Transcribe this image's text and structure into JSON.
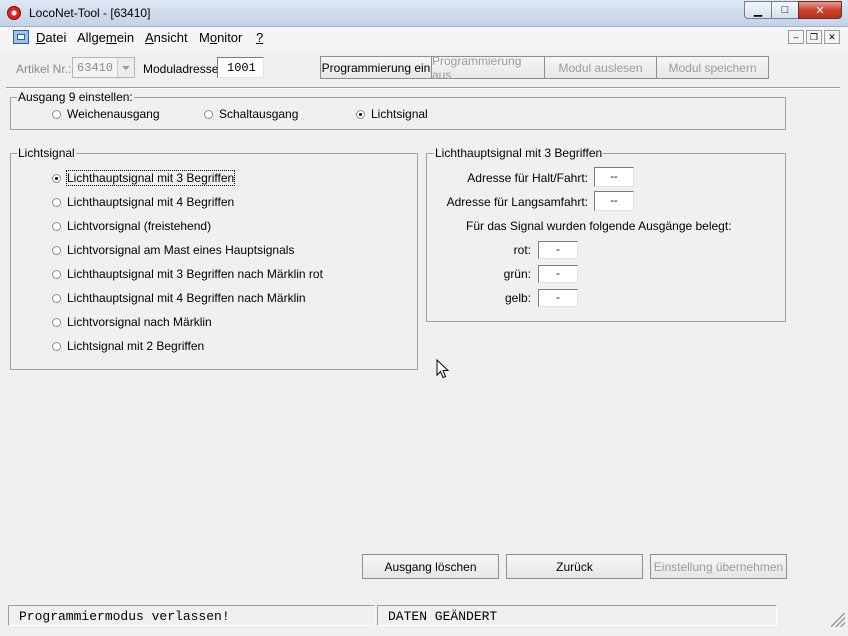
{
  "window": {
    "title": "LocoNet-Tool - [63410]"
  },
  "menu": {
    "items": [
      "Datei",
      "Allgemein",
      "Ansicht",
      "Monitor",
      "?"
    ],
    "mnemonics": [
      "D",
      "m",
      "A",
      "o",
      "?"
    ]
  },
  "toolbar": {
    "artikel_label": "Artikel Nr.:",
    "artikel_value": "63410",
    "modul_label": "Moduladresse:",
    "modul_value": "1001",
    "buttons": [
      {
        "label": "Programmierung ein",
        "enabled": true
      },
      {
        "label": "Programmierung aus",
        "enabled": false
      },
      {
        "label": "Modul auslesen",
        "enabled": false
      },
      {
        "label": "Modul speichern",
        "enabled": false
      }
    ]
  },
  "ausgang": {
    "title": "Ausgang 9 einstellen:",
    "options": [
      {
        "label": "Weichenausgang",
        "selected": false
      },
      {
        "label": "Schaltausgang",
        "selected": false
      },
      {
        "label": "Lichtsignal",
        "selected": true
      }
    ]
  },
  "lichtsignal": {
    "title": "Lichtsignal",
    "options": [
      {
        "label": "Lichthauptsignal mit 3 Begriffen",
        "selected": true
      },
      {
        "label": "Lichthauptsignal mit 4 Begriffen",
        "selected": false
      },
      {
        "label": "Lichtvorsignal (freistehend)",
        "selected": false
      },
      {
        "label": "Lichtvorsignal am Mast eines Hauptsignals",
        "selected": false
      },
      {
        "label": "Lichthauptsignal mit 3 Begriffen nach Märklin rot",
        "selected": false
      },
      {
        "label": "Lichthauptsignal mit 4 Begriffen nach Märklin",
        "selected": false
      },
      {
        "label": "Lichtvorsignal nach Märklin",
        "selected": false
      },
      {
        "label": "Lichtsignal mit 2 Begriffen",
        "selected": false
      }
    ]
  },
  "detail": {
    "title": "Lichthauptsignal mit 3 Begriffen",
    "halt_label": "Adresse für Halt/Fahrt:",
    "halt_value": "--",
    "langsam_label": "Adresse für Langsamfahrt:",
    "langsam_value": "--",
    "info": "Für das Signal wurden folgende Ausgänge belegt:",
    "rot_label": "rot:",
    "rot_value": "-",
    "gruen_label": "grün:",
    "gruen_value": "-",
    "gelb_label": "gelb:",
    "gelb_value": "-"
  },
  "actions": {
    "loeschen": "Ausgang löschen",
    "zurueck": "Zurück",
    "uebernehmen": "Einstellung übernehmen"
  },
  "statusbar": {
    "left": "Programmiermodus verlassen!",
    "right": "DATEN GEÄNDERT"
  }
}
